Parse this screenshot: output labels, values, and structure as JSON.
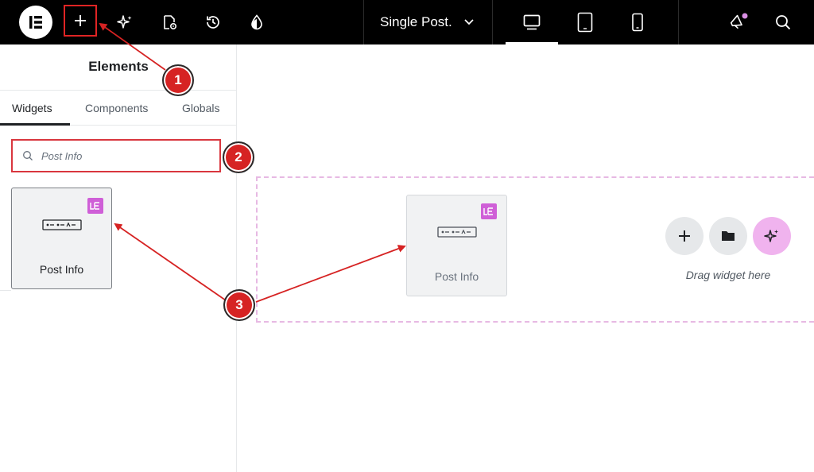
{
  "topbar": {
    "document_title": "Single Post.",
    "icons": [
      "elementor-logo-icon",
      "add-icon",
      "ai-sparkle-icon",
      "page-settings-icon",
      "history-icon",
      "site-settings-icon",
      "desktop-icon",
      "tablet-icon",
      "mobile-icon",
      "announcements-icon",
      "search-icon"
    ]
  },
  "sidebar": {
    "title": "Elements",
    "tabs": [
      {
        "label": "Widgets",
        "active": true
      },
      {
        "label": "Components",
        "active": false
      },
      {
        "label": "Globals",
        "active": false
      }
    ],
    "search": {
      "value": "",
      "placeholder": "Post Info"
    },
    "widget": {
      "label": "Post Info",
      "badge_icon": "pro-badge-icon"
    }
  },
  "canvas": {
    "ghost_widget_label": "Post Info",
    "drag_text": "Drag widget here",
    "buttons": [
      "add-section-icon",
      "template-folder-icon",
      "ai-sparkle-icon"
    ]
  },
  "annotations": {
    "badges": [
      "1",
      "2",
      "3"
    ],
    "color": "#d62323"
  },
  "colors": {
    "topbar_bg": "#000000",
    "accent_pink": "#e7b9e3",
    "pro_badge": "#cf5fd7",
    "highlight_red": "#d9363e"
  }
}
